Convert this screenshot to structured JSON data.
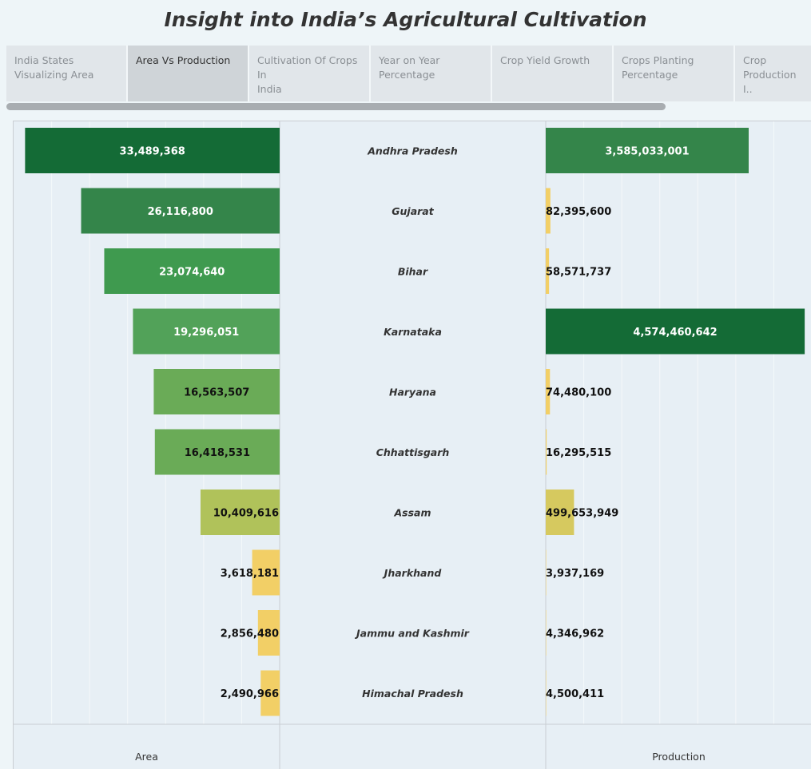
{
  "title": "Insight into India’s Agricultural Cultivation",
  "tabs": [
    {
      "label": "India States\nVisualizing Area",
      "active": false
    },
    {
      "label": "Area Vs Production",
      "active": true
    },
    {
      "label": "Cultivation Of Crops In\nIndia",
      "active": false
    },
    {
      "label": "Year on Year\nPercentage",
      "active": false
    },
    {
      "label": "Crop Yield Growth",
      "active": false
    },
    {
      "label": "Crops Planting\nPercentage",
      "active": false
    },
    {
      "label": "Crop\nProduction I..",
      "active": false
    }
  ],
  "colors": {
    "dark_green": "#146b36",
    "green": "#34854a",
    "mid_green": "#3f9a4f",
    "light_green": "#52a259",
    "lime_green": "#6aab57",
    "olive": "#b0c25a",
    "yellow": "#f2cf66",
    "mustard": "#d6c95f"
  },
  "chart_data": {
    "type": "bar",
    "categories": [
      "Andhra Pradesh",
      "Gujarat",
      "Bihar",
      "Karnataka",
      "Haryana",
      "Chhattisgarh",
      "Assam",
      "Jharkhand",
      "Jammu and Kashmir",
      "Himachal Pradesh"
    ],
    "series": [
      {
        "name": "Area",
        "values": [
          33489368,
          26116800,
          23074640,
          19296051,
          16563507,
          16418531,
          10409616,
          3618181,
          2856480,
          2490966
        ],
        "labels": [
          "33,489,368",
          "26,116,800",
          "23,074,640",
          "19,296,051",
          "16,563,507",
          "16,418,531",
          "10,409,616",
          "3,618,181",
          "2,856,480",
          "2,490,966"
        ]
      },
      {
        "name": "Production",
        "values": [
          3585033001,
          82395600,
          58571737,
          4574460642,
          74480100,
          16295515,
          499653949,
          3937169,
          4346962,
          4500411
        ],
        "labels": [
          "3,585,033,001",
          "82,395,600",
          "58,571,737",
          "4,574,460,642",
          "74,480,100",
          "16,295,515",
          "499,653,949",
          "3,937,169",
          "4,346,962",
          "4,500,411"
        ]
      }
    ],
    "xlabel_left": "Area",
    "xlabel_right": "Production",
    "area_colors": [
      "#146b36",
      "#34854a",
      "#3f9a4f",
      "#52a259",
      "#6aab57",
      "#6aab57",
      "#b0c25a",
      "#f2cf66",
      "#f2cf66",
      "#f2cf66"
    ],
    "production_colors": [
      "#34854a",
      "#f2cf66",
      "#f2cf66",
      "#146b36",
      "#f2cf66",
      "#f2cf66",
      "#d6c95f",
      "#f2cf66",
      "#f2cf66",
      "#f2cf66"
    ],
    "area_label_colors": [
      "#ffffff",
      "#ffffff",
      "#ffffff",
      "#ffffff",
      "#111111",
      "#111111",
      "#111111",
      "#111111",
      "#111111",
      "#111111"
    ],
    "production_label_colors": [
      "#ffffff",
      "#111111",
      "#111111",
      "#ffffff",
      "#111111",
      "#111111",
      "#111111",
      "#111111",
      "#111111",
      "#111111"
    ],
    "area_axis_max": 35000000,
    "production_axis_max": 4700000000,
    "grid": true
  }
}
